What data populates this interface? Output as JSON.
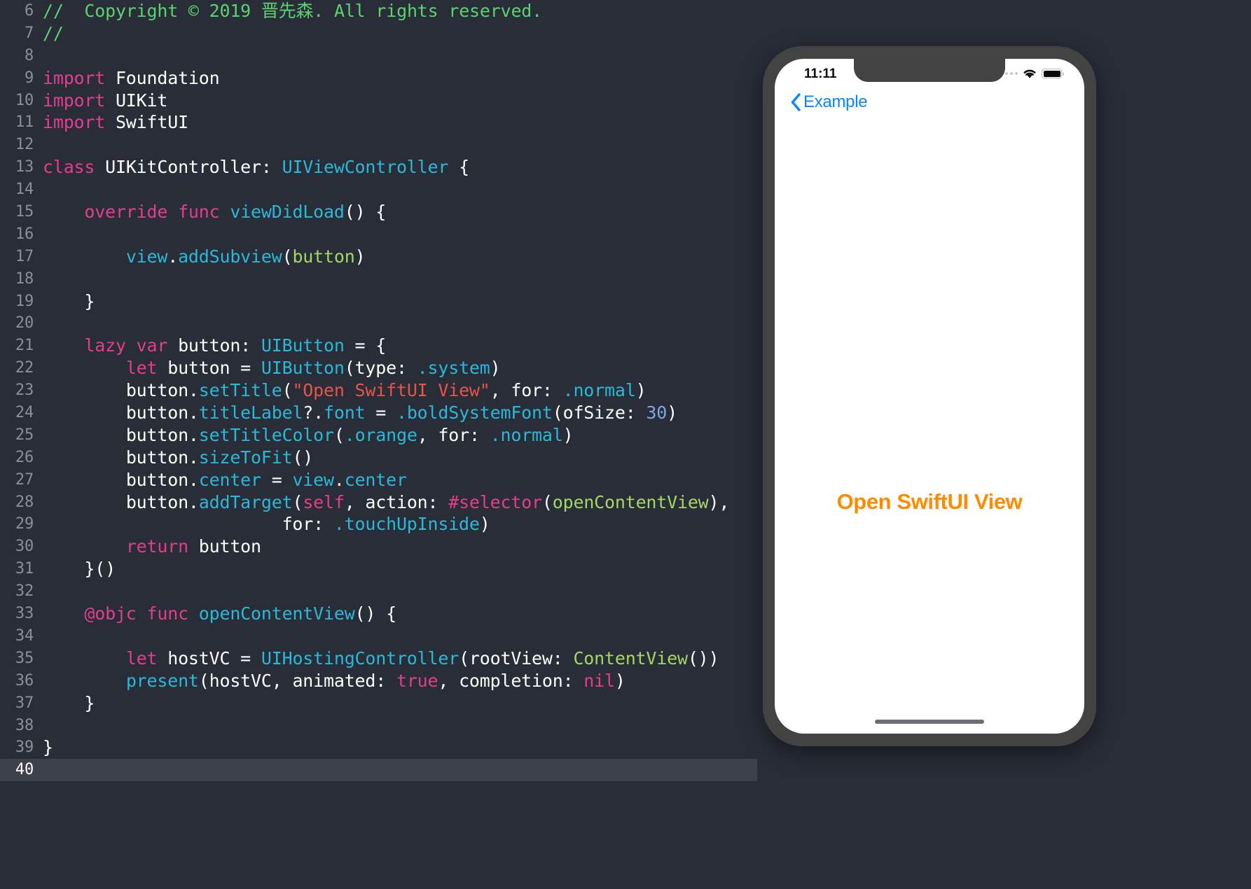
{
  "editor": {
    "theme_bg": "#292d38",
    "gutter_color": "#8a8f9c",
    "current_line": 40,
    "lines": [
      {
        "num": 6,
        "tokens": [
          {
            "t": "//  Copyright © 2019 晋先森. All rights reserved.",
            "c": "t-com"
          }
        ]
      },
      {
        "num": 7,
        "tokens": [
          {
            "t": "//",
            "c": "t-com"
          }
        ]
      },
      {
        "num": 8,
        "tokens": []
      },
      {
        "num": 9,
        "tokens": [
          {
            "t": "import",
            "c": "t-key"
          },
          {
            "t": " Foundation",
            "c": "t-plain"
          }
        ]
      },
      {
        "num": 10,
        "tokens": [
          {
            "t": "import",
            "c": "t-key"
          },
          {
            "t": " UIKit",
            "c": "t-plain"
          }
        ]
      },
      {
        "num": 11,
        "tokens": [
          {
            "t": "import",
            "c": "t-key"
          },
          {
            "t": " SwiftUI",
            "c": "t-plain"
          }
        ]
      },
      {
        "num": 12,
        "tokens": []
      },
      {
        "num": 13,
        "tokens": [
          {
            "t": "class",
            "c": "t-key"
          },
          {
            "t": " UIKitController",
            "c": "t-plain"
          },
          {
            "t": ": ",
            "c": "t-plain"
          },
          {
            "t": "UIViewController",
            "c": "t-type"
          },
          {
            "t": " {",
            "c": "t-plain"
          }
        ]
      },
      {
        "num": 14,
        "tokens": []
      },
      {
        "num": 15,
        "tokens": [
          {
            "t": "    ",
            "c": "t-plain"
          },
          {
            "t": "override func",
            "c": "t-key"
          },
          {
            "t": " ",
            "c": "t-plain"
          },
          {
            "t": "viewDidLoad",
            "c": "t-fn"
          },
          {
            "t": "() {",
            "c": "t-plain"
          }
        ]
      },
      {
        "num": 16,
        "tokens": []
      },
      {
        "num": 17,
        "tokens": [
          {
            "t": "        ",
            "c": "t-plain"
          },
          {
            "t": "view",
            "c": "t-type"
          },
          {
            "t": ".",
            "c": "t-plain"
          },
          {
            "t": "addSubview",
            "c": "t-fn"
          },
          {
            "t": "(",
            "c": "t-plain"
          },
          {
            "t": "button",
            "c": "t-id"
          },
          {
            "t": ")",
            "c": "t-plain"
          }
        ]
      },
      {
        "num": 18,
        "tokens": []
      },
      {
        "num": 19,
        "tokens": [
          {
            "t": "    }",
            "c": "t-plain"
          }
        ]
      },
      {
        "num": 20,
        "tokens": []
      },
      {
        "num": 21,
        "tokens": [
          {
            "t": "    ",
            "c": "t-plain"
          },
          {
            "t": "lazy var",
            "c": "t-key"
          },
          {
            "t": " button: ",
            "c": "t-plain"
          },
          {
            "t": "UIButton",
            "c": "t-type"
          },
          {
            "t": " = {",
            "c": "t-plain"
          }
        ]
      },
      {
        "num": 22,
        "tokens": [
          {
            "t": "        ",
            "c": "t-plain"
          },
          {
            "t": "let",
            "c": "t-key"
          },
          {
            "t": " button = ",
            "c": "t-plain"
          },
          {
            "t": "UIButton",
            "c": "t-type"
          },
          {
            "t": "(type: ",
            "c": "t-plain"
          },
          {
            "t": ".system",
            "c": "t-type"
          },
          {
            "t": ")",
            "c": "t-plain"
          }
        ]
      },
      {
        "num": 23,
        "tokens": [
          {
            "t": "        ",
            "c": "t-plain"
          },
          {
            "t": "button.",
            "c": "t-plain"
          },
          {
            "t": "setTitle",
            "c": "t-fn"
          },
          {
            "t": "(",
            "c": "t-plain"
          },
          {
            "t": "\"Open SwiftUI View\"",
            "c": "t-str"
          },
          {
            "t": ", for: ",
            "c": "t-plain"
          },
          {
            "t": ".normal",
            "c": "t-type"
          },
          {
            "t": ")",
            "c": "t-plain"
          }
        ]
      },
      {
        "num": 24,
        "tokens": [
          {
            "t": "        ",
            "c": "t-plain"
          },
          {
            "t": "button.",
            "c": "t-plain"
          },
          {
            "t": "titleLabel",
            "c": "t-fn"
          },
          {
            "t": "?.",
            "c": "t-plain"
          },
          {
            "t": "font",
            "c": "t-fn"
          },
          {
            "t": " = ",
            "c": "t-plain"
          },
          {
            "t": ".boldSystemFont",
            "c": "t-type"
          },
          {
            "t": "(ofSize: ",
            "c": "t-plain"
          },
          {
            "t": "30",
            "c": "t-num"
          },
          {
            "t": ")",
            "c": "t-plain"
          }
        ]
      },
      {
        "num": 25,
        "tokens": [
          {
            "t": "        ",
            "c": "t-plain"
          },
          {
            "t": "button.",
            "c": "t-plain"
          },
          {
            "t": "setTitleColor",
            "c": "t-fn"
          },
          {
            "t": "(",
            "c": "t-plain"
          },
          {
            "t": ".orange",
            "c": "t-type"
          },
          {
            "t": ", for: ",
            "c": "t-plain"
          },
          {
            "t": ".normal",
            "c": "t-type"
          },
          {
            "t": ")",
            "c": "t-plain"
          }
        ]
      },
      {
        "num": 26,
        "tokens": [
          {
            "t": "        ",
            "c": "t-plain"
          },
          {
            "t": "button.",
            "c": "t-plain"
          },
          {
            "t": "sizeToFit",
            "c": "t-fn"
          },
          {
            "t": "()",
            "c": "t-plain"
          }
        ]
      },
      {
        "num": 27,
        "tokens": [
          {
            "t": "        ",
            "c": "t-plain"
          },
          {
            "t": "button.",
            "c": "t-plain"
          },
          {
            "t": "center",
            "c": "t-fn"
          },
          {
            "t": " = ",
            "c": "t-plain"
          },
          {
            "t": "view",
            "c": "t-type"
          },
          {
            "t": ".",
            "c": "t-plain"
          },
          {
            "t": "center",
            "c": "t-fn"
          },
          {
            "t": "",
            "c": "t-plain"
          }
        ]
      },
      {
        "num": 28,
        "tokens": [
          {
            "t": "        ",
            "c": "t-plain"
          },
          {
            "t": "button.",
            "c": "t-plain"
          },
          {
            "t": "addTarget",
            "c": "t-fn"
          },
          {
            "t": "(",
            "c": "t-plain"
          },
          {
            "t": "self",
            "c": "t-pink"
          },
          {
            "t": ", action: ",
            "c": "t-plain"
          },
          {
            "t": "#selector",
            "c": "t-pink"
          },
          {
            "t": "(",
            "c": "t-plain"
          },
          {
            "t": "openContentView",
            "c": "t-id"
          },
          {
            "t": "),",
            "c": "t-plain"
          }
        ]
      },
      {
        "num": 29,
        "tokens": [
          {
            "t": "                       for: ",
            "c": "t-plain"
          },
          {
            "t": ".touchUpInside",
            "c": "t-type"
          },
          {
            "t": ")",
            "c": "t-plain"
          }
        ]
      },
      {
        "num": 30,
        "tokens": [
          {
            "t": "        ",
            "c": "t-plain"
          },
          {
            "t": "return",
            "c": "t-key"
          },
          {
            "t": " button",
            "c": "t-plain"
          }
        ]
      },
      {
        "num": 31,
        "tokens": [
          {
            "t": "    }()",
            "c": "t-plain"
          }
        ]
      },
      {
        "num": 32,
        "tokens": []
      },
      {
        "num": 33,
        "tokens": [
          {
            "t": "    ",
            "c": "t-plain"
          },
          {
            "t": "@objc func",
            "c": "t-key"
          },
          {
            "t": " ",
            "c": "t-plain"
          },
          {
            "t": "openContentView",
            "c": "t-fn"
          },
          {
            "t": "() {",
            "c": "t-plain"
          }
        ]
      },
      {
        "num": 34,
        "tokens": []
      },
      {
        "num": 35,
        "tokens": [
          {
            "t": "        ",
            "c": "t-plain"
          },
          {
            "t": "let",
            "c": "t-key"
          },
          {
            "t": " hostVC = ",
            "c": "t-plain"
          },
          {
            "t": "UIHostingController",
            "c": "t-type"
          },
          {
            "t": "(rootView: ",
            "c": "t-plain"
          },
          {
            "t": "ContentView",
            "c": "t-id"
          },
          {
            "t": "())",
            "c": "t-plain"
          }
        ]
      },
      {
        "num": 36,
        "tokens": [
          {
            "t": "        ",
            "c": "t-plain"
          },
          {
            "t": "present",
            "c": "t-fn"
          },
          {
            "t": "(hostVC, animated: ",
            "c": "t-plain"
          },
          {
            "t": "true",
            "c": "t-pink"
          },
          {
            "t": ", completion: ",
            "c": "t-plain"
          },
          {
            "t": "nil",
            "c": "t-pink"
          },
          {
            "t": ")",
            "c": "t-plain"
          }
        ]
      },
      {
        "num": 37,
        "tokens": [
          {
            "t": "    }",
            "c": "t-plain"
          }
        ]
      },
      {
        "num": 38,
        "tokens": []
      },
      {
        "num": 39,
        "tokens": [
          {
            "t": "}",
            "c": "t-plain"
          }
        ]
      },
      {
        "num": 40,
        "tokens": []
      }
    ]
  },
  "simulator": {
    "status_bar": {
      "time": "11:11",
      "signal_icon": "signal-dots-icon",
      "wifi_icon": "wifi-icon",
      "battery_icon": "battery-full-icon"
    },
    "nav": {
      "back_icon": "chevron-left-icon",
      "back_label": "Example"
    },
    "content": {
      "button_label": "Open SwiftUI View",
      "button_color": "#ff8c00"
    },
    "home_indicator": "home-indicator"
  }
}
